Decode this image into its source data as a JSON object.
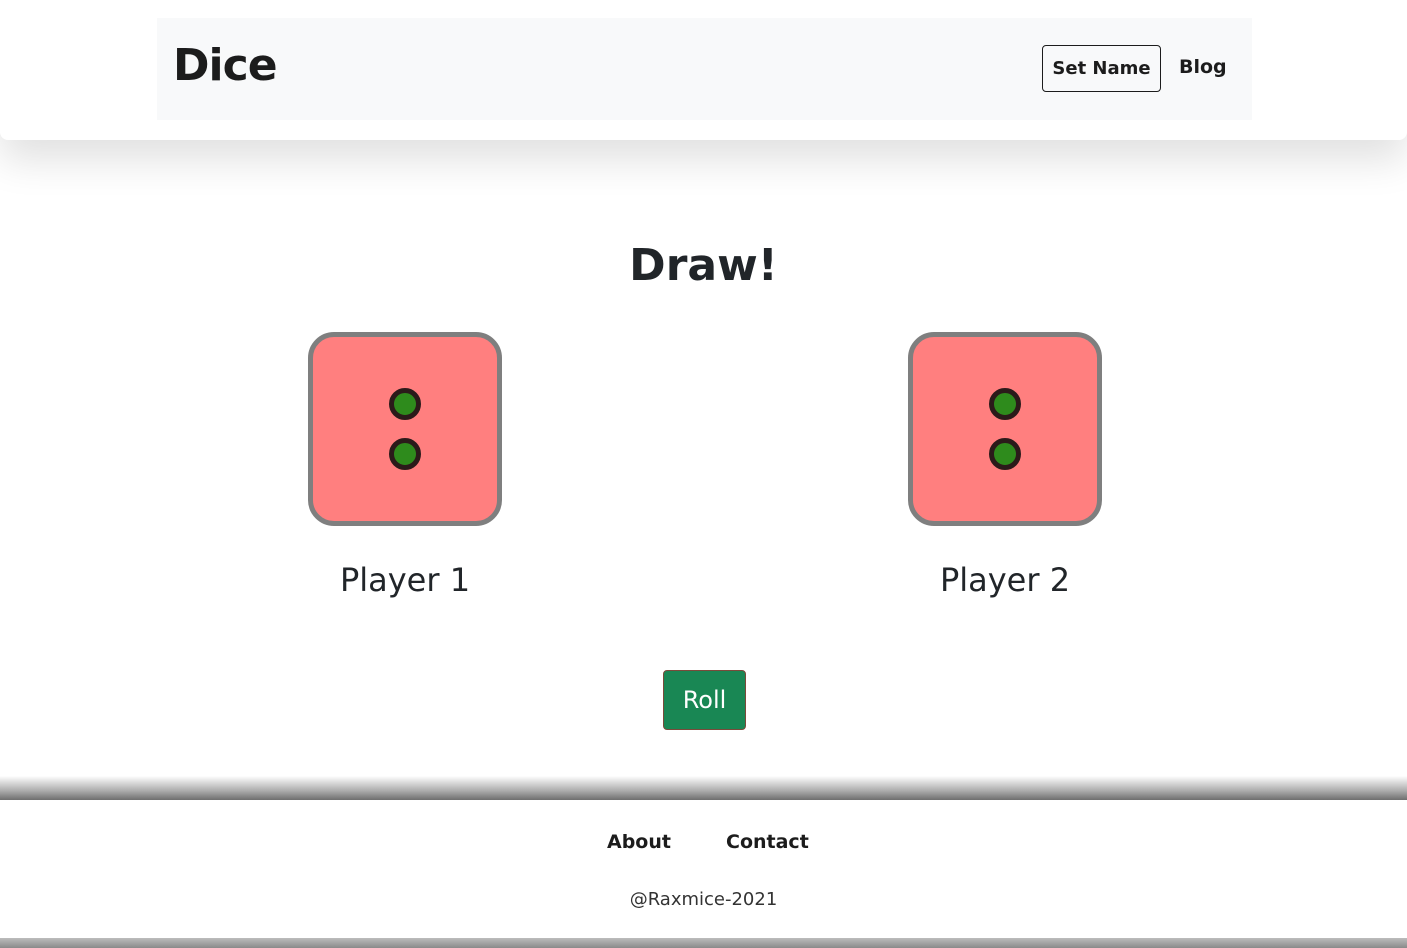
{
  "header": {
    "brand": "Dice",
    "set_name_label": "Set Name",
    "blog_label": "Blog"
  },
  "main": {
    "result": "Draw!",
    "players": [
      {
        "name": "Player 1",
        "die_value": 2
      },
      {
        "name": "Player 2",
        "die_value": 2
      }
    ],
    "roll_label": "Roll"
  },
  "footer": {
    "links": [
      "About",
      "Contact"
    ],
    "copyright": "@Raxmice-2021"
  },
  "colors": {
    "die_face": "#ff7f7f",
    "die_border": "#7f7f7f",
    "pip_fill": "#2e8b1c",
    "pip_ring": "#2b1a1a",
    "roll_button": "#198754",
    "navbar_bg": "#f8f9fa"
  }
}
